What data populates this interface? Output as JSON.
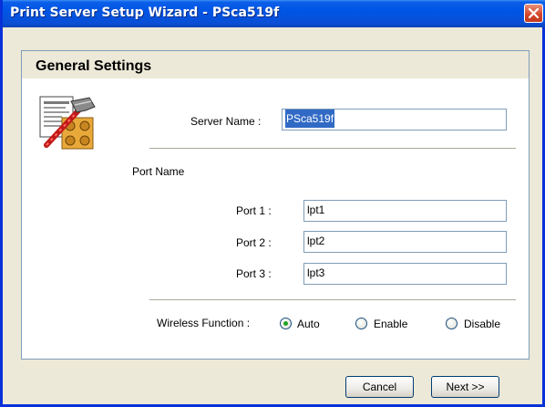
{
  "window": {
    "title": "Print Server Setup Wizard - PSca519f"
  },
  "header": {
    "title": "General Settings"
  },
  "server": {
    "label": "Server Name :",
    "value": "PSca519f"
  },
  "ports": {
    "section_label": "Port Name",
    "items": [
      {
        "label": "Port 1 :",
        "value": "lpt1"
      },
      {
        "label": "Port 2 :",
        "value": "lpt2"
      },
      {
        "label": "Port 3 :",
        "value": "lpt3"
      }
    ]
  },
  "wireless": {
    "label": "Wireless Function :",
    "options": [
      "Auto",
      "Enable",
      "Disable"
    ],
    "selected": "Auto"
  },
  "buttons": {
    "cancel": "Cancel",
    "next": "Next >>"
  },
  "icons": {
    "close": "close-icon",
    "wizard": "wizard-tools-icon"
  },
  "colors": {
    "titlebar": "#0055e5",
    "close_button": "#d4432a",
    "selection": "#316ac5",
    "radio_checked": "#21a121"
  }
}
